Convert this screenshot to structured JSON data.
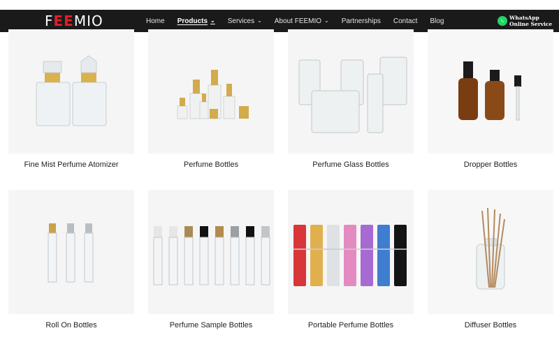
{
  "header": {
    "logo": {
      "part1": "F",
      "part2": "EE",
      "part3": "MIO"
    },
    "nav": [
      {
        "label": "Home",
        "active": false,
        "dropdown": false
      },
      {
        "label": "Products",
        "active": true,
        "dropdown": true
      },
      {
        "label": "Services",
        "active": false,
        "dropdown": true
      },
      {
        "label": "About FEEMIO",
        "active": false,
        "dropdown": true
      },
      {
        "label": "Partnerships",
        "active": false,
        "dropdown": false
      },
      {
        "label": "Contact",
        "active": false,
        "dropdown": false
      },
      {
        "label": "Blog",
        "active": false,
        "dropdown": false
      }
    ],
    "whatsapp": {
      "line1": "WhatsApp",
      "line2": "Online Service",
      "icon": "whatsapp-icon",
      "color": "#25d366"
    }
  },
  "products": [
    {
      "title": "Fine Mist Perfume Atomizer"
    },
    {
      "title": "Perfume Bottles"
    },
    {
      "title": "Perfume Glass Bottles"
    },
    {
      "title": "Dropper Bottles"
    },
    {
      "title": "Roll On Bottles"
    },
    {
      "title": "Perfume Sample Bottles"
    },
    {
      "title": "Portable Perfume Bottles"
    },
    {
      "title": "Diffuser Bottles"
    }
  ],
  "colors": {
    "navbar": "#1a1a1a",
    "brand_red": "#e01f2a",
    "card_bg": "#f3f3f3",
    "gold": "#c9a24a",
    "amber_glass": "#7a3d12"
  }
}
